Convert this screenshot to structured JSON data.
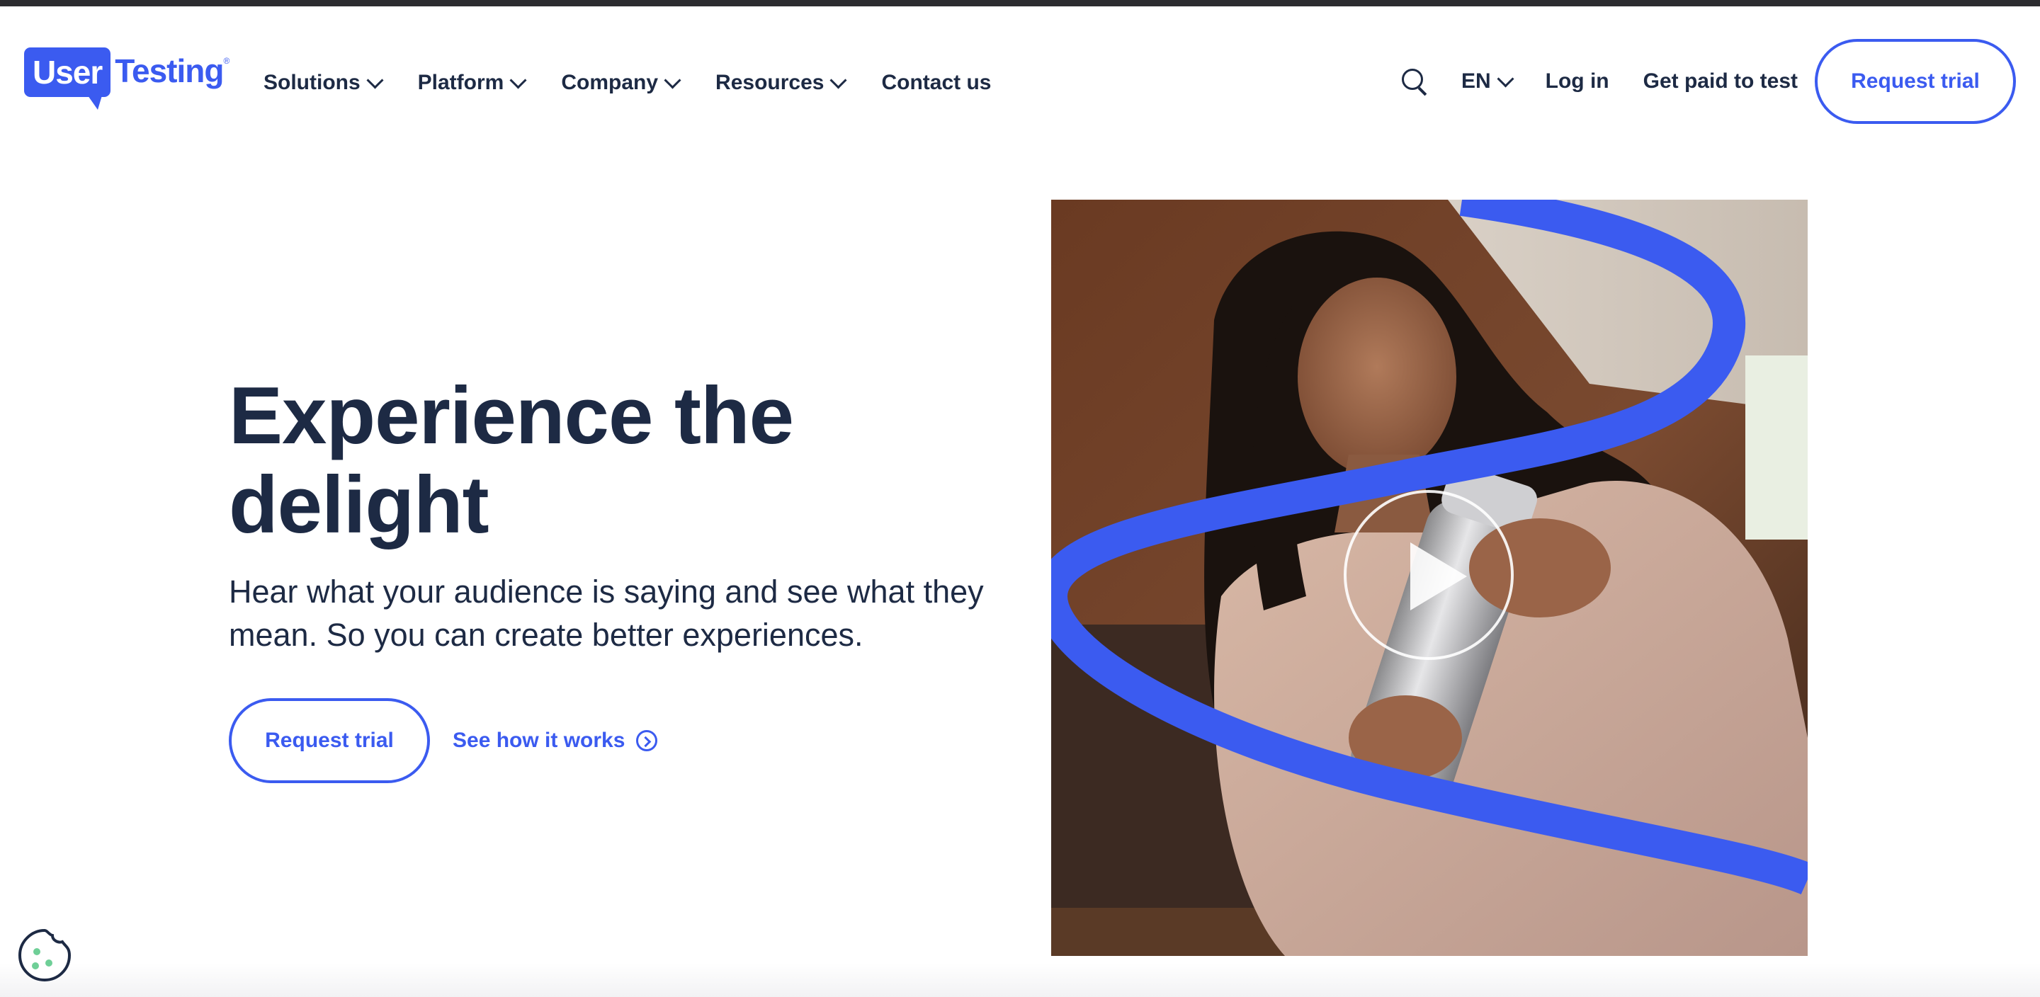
{
  "brand": {
    "logo_part1": "User",
    "logo_part2": "Testing",
    "reg": "®",
    "accent": "#3b5bf0",
    "text_color": "#1d2a44"
  },
  "nav": {
    "items": [
      {
        "label": "Solutions",
        "dropdown": true
      },
      {
        "label": "Platform",
        "dropdown": true
      },
      {
        "label": "Company",
        "dropdown": true
      },
      {
        "label": "Resources",
        "dropdown": true
      },
      {
        "label": "Contact us",
        "dropdown": false
      }
    ]
  },
  "header_right": {
    "search_icon": "search-icon",
    "language": "EN",
    "login": "Log in",
    "get_paid": "Get paid to test",
    "cta": "Request trial"
  },
  "hero": {
    "title": "Experience the delight",
    "subtitle": "Hear what your audience is saying and see what they mean. So you can create better experiences.",
    "primary_cta": "Request trial",
    "secondary_cta": "See how it works"
  },
  "media": {
    "play_icon": "play-icon"
  },
  "cookie": {
    "icon": "cookie-icon"
  }
}
